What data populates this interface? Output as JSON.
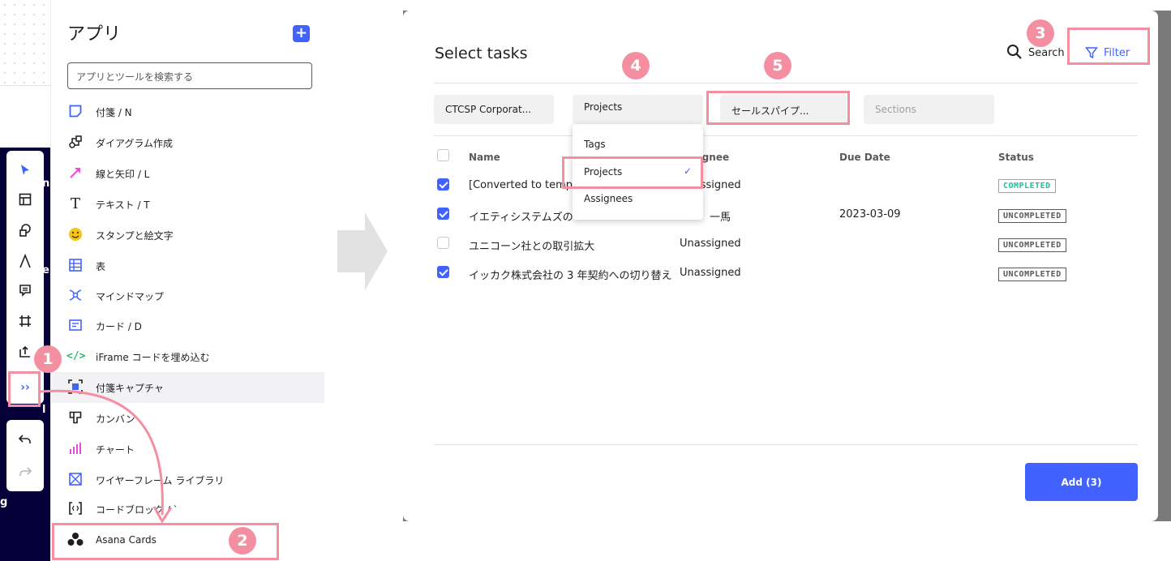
{
  "panel": {
    "title": "アプリ",
    "add_label": "+",
    "search_placeholder": "アプリとツールを検索する",
    "items": [
      {
        "label": "付箋 / N",
        "icon": "sticky-note-icon"
      },
      {
        "label": "ダイアグラム作成",
        "icon": "diagram-icon"
      },
      {
        "label": "線と矢印 / L",
        "icon": "arrow-icon"
      },
      {
        "label": "テキスト / T",
        "icon": "text-icon"
      },
      {
        "label": "スタンプと絵文字",
        "icon": "emoji-icon"
      },
      {
        "label": "表",
        "icon": "table-icon"
      },
      {
        "label": "マインドマップ",
        "icon": "mindmap-icon"
      },
      {
        "label": "カード / D",
        "icon": "card-icon"
      },
      {
        "label": "iFrame コードを埋め込む",
        "icon": "iframe-icon"
      },
      {
        "label": "付箋キャプチャ",
        "icon": "capture-icon"
      },
      {
        "label": "カンバン",
        "icon": "kanban-icon"
      },
      {
        "label": "チャート",
        "icon": "chart-icon"
      },
      {
        "label": "ワイヤーフレーム ライブラリ",
        "icon": "wireframe-icon"
      },
      {
        "label": "コードブロック / `",
        "icon": "code-block-icon"
      },
      {
        "label": "Asana Cards",
        "icon": "asana-icon"
      }
    ]
  },
  "toolbar": {
    "more_label": "››"
  },
  "modal": {
    "title": "Select tasks",
    "search_label": "Search",
    "filter_label": "Filter",
    "filters": {
      "workspace": "CTCSP Corporat...",
      "type": "Projects",
      "project": "セールスパイプ...",
      "sections": "Sections"
    },
    "dropdown": {
      "items": [
        "Tags",
        "Projects",
        "Assignees"
      ],
      "checkmark": "✓"
    },
    "columns": {
      "name": "Name",
      "assignee": "Assignee",
      "due_date": "Due Date",
      "status": "Status"
    },
    "rows": [
      {
        "name": "[Converted to template]",
        "assignee": "Unassigned",
        "due": "",
        "status": "COMPLETED",
        "checked": true
      },
      {
        "name": "イエティシステムズの",
        "assignee": "一馬",
        "due": "2023-03-09",
        "status": "UNCOMPLETED",
        "checked": true
      },
      {
        "name": "ユニコーン社との取引拡大",
        "assignee": "Unassigned",
        "due": "",
        "status": "UNCOMPLETED",
        "checked": false
      },
      {
        "name": "イッカク株式会社の 3 年契約への切り替え",
        "assignee": "Unassigned",
        "due": "",
        "status": "UNCOMPLETED",
        "checked": true
      }
    ],
    "add_button": "Add (3)"
  },
  "annotations": [
    "1",
    "2",
    "3",
    "4",
    "5"
  ],
  "colors": {
    "accent": "#4262ff",
    "highlight": "#f48fa1",
    "completed": "#1fbf9f"
  }
}
